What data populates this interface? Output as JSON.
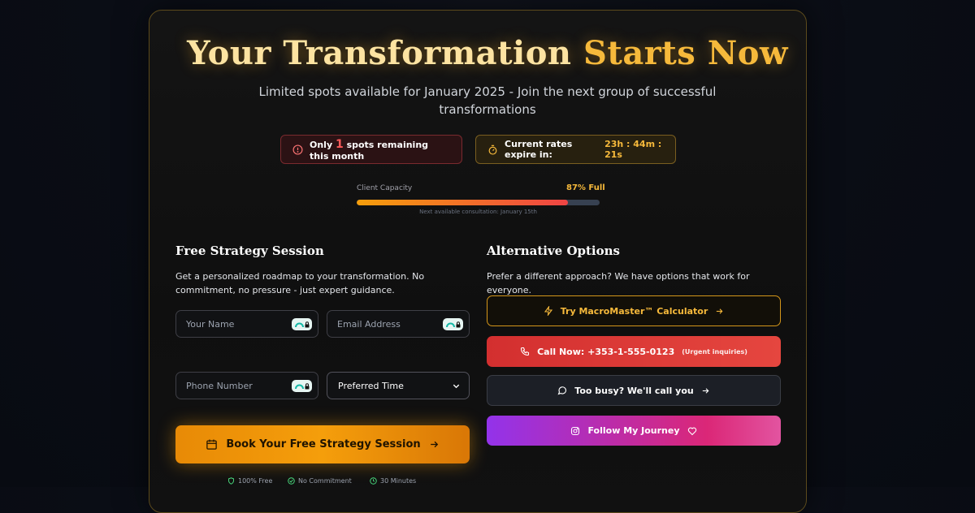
{
  "hero": {
    "title_main": "Your Transformation",
    "title_accent": "Starts Now",
    "subtitle": "Limited spots available for January 2025 - Join the next group of successful transformations"
  },
  "badges": {
    "spots_prefix": "Only",
    "spots_count": "1",
    "spots_suffix": "spots remaining this month",
    "rates_label": "Current rates expire in:",
    "countdown": "23h : 44m : 21s"
  },
  "capacity": {
    "label": "Client Capacity",
    "percent_text": "87% Full",
    "fraction": 0.87,
    "note": "Next available consultation: January 15th"
  },
  "strategy": {
    "title": "Free Strategy Session",
    "description": "Get a personalized roadmap to your transformation. No commitment, no pressure - just expert guidance.",
    "name_placeholder": "Your Name",
    "email_placeholder": "Email Address",
    "phone_placeholder": "Phone Number",
    "time_select": "Preferred Time",
    "book_label": "Book Your Free Strategy Session",
    "trust": [
      "100% Free",
      "No Commitment",
      "30 Minutes"
    ]
  },
  "alternatives": {
    "title": "Alternative Options",
    "description": "Prefer a different approach? We have options that work for everyone.",
    "calculator": "Try MacroMaster™ Calculator",
    "call_label": "Call Now: +353-1-555-0123",
    "call_note": "(Urgent inquiries)",
    "callback": "Too busy? We'll call you",
    "follow": "Follow My Journey"
  },
  "colors": {
    "accent": "#f6b93b",
    "danger": "#ef4444",
    "instagram_start": "#9333ea",
    "instagram_end": "#db2777"
  },
  "icons": [
    "alert-circle-icon",
    "stopwatch-icon",
    "password-manager-icon",
    "chevron-down-icon",
    "calendar-icon",
    "arrow-right-icon",
    "shield-icon",
    "check-circle-icon",
    "clock-icon",
    "lightning-icon",
    "phone-icon",
    "chat-bubble-icon",
    "instagram-icon",
    "heart-icon"
  ]
}
